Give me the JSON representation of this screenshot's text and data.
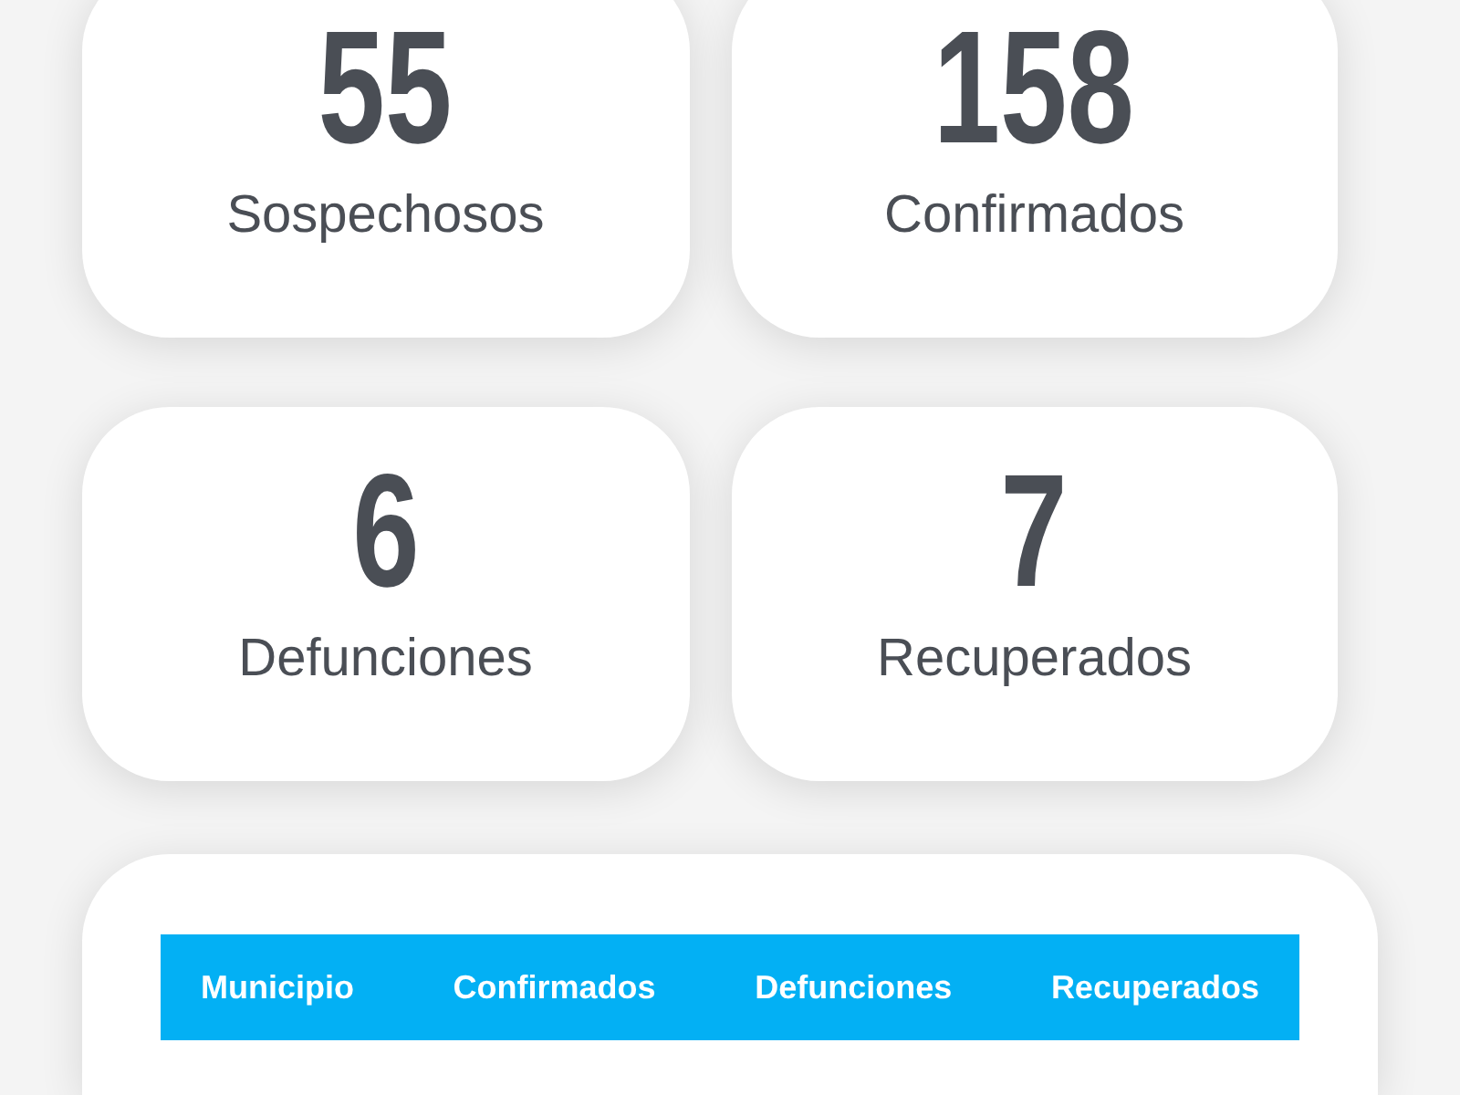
{
  "stats": [
    {
      "value": "55",
      "label": "Sospechosos"
    },
    {
      "value": "158",
      "label": "Confirmados"
    },
    {
      "value": "6",
      "label": "Defunciones"
    },
    {
      "value": "7",
      "label": "Recuperados"
    }
  ],
  "table": {
    "columns": [
      "Municipio",
      "Confirmados",
      "Defunciones",
      "Recuperados"
    ]
  }
}
